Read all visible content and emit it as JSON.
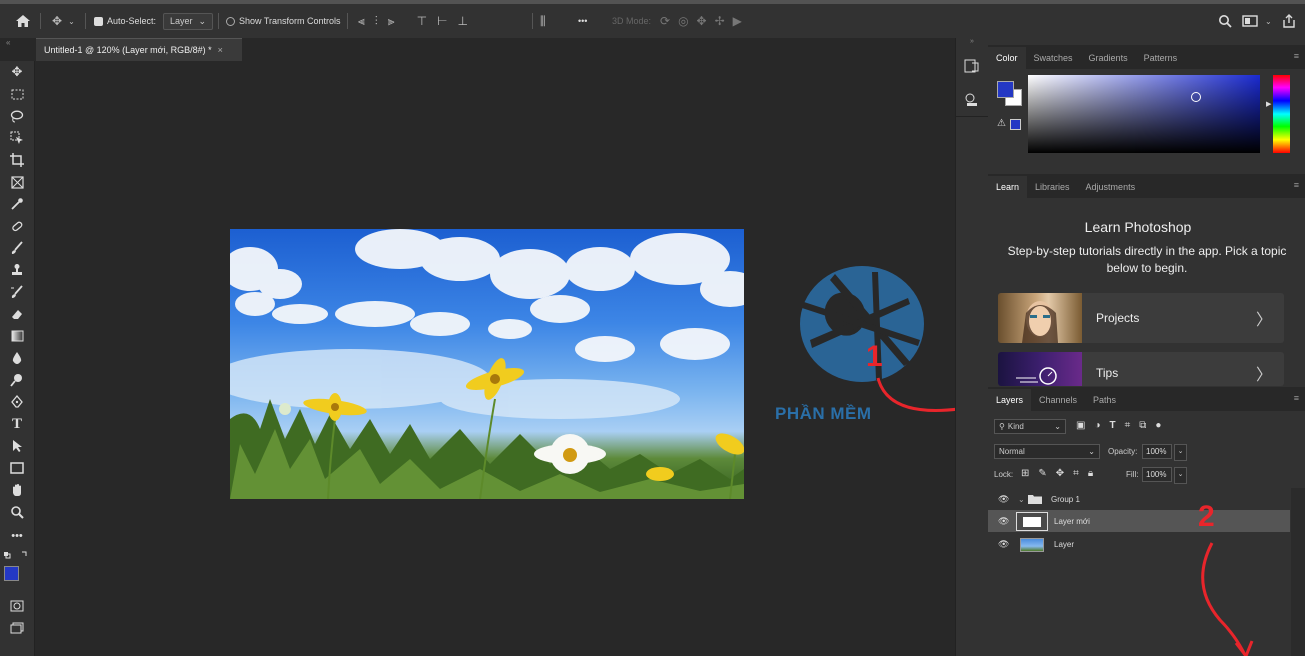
{
  "options_bar": {
    "auto_select_label": "Auto-Select:",
    "auto_select_value": "Layer",
    "show_transform_label": "Show Transform Controls",
    "threed_mode_label": "3D Mode:",
    "more_label": "•••"
  },
  "document": {
    "tab_title": "Untitled-1 @ 120% (Layer mới, RGB/8#) *",
    "close_label": "×"
  },
  "color_panel": {
    "tabs": [
      "Color",
      "Swatches",
      "Gradients",
      "Patterns"
    ],
    "foreground": "#2438c4",
    "background": "#ffffff"
  },
  "learn_panel": {
    "tabs": [
      "Learn",
      "Libraries",
      "Adjustments"
    ],
    "title": "Learn Photoshop",
    "description": "Step-by-step tutorials directly in the app. Pick a topic below to begin.",
    "cards": [
      {
        "label": "Projects"
      },
      {
        "label": "Tips"
      }
    ]
  },
  "layers_panel": {
    "tabs": [
      "Layers",
      "Channels",
      "Paths"
    ],
    "kind_label": "Kind",
    "blend_mode": "Normal",
    "opacity_label": "Opacity:",
    "opacity_value": "100%",
    "lock_label": "Lock:",
    "fill_label": "Fill:",
    "fill_value": "100%",
    "layers": [
      {
        "name": "Group 1",
        "type": "group",
        "selected": false
      },
      {
        "name": "Layer mới",
        "type": "layer",
        "selected": true
      },
      {
        "name": "Layer",
        "type": "image",
        "selected": false
      }
    ]
  },
  "watermark": {
    "text": "PHẦN MỀM"
  },
  "annotations": {
    "one": "1",
    "two": "2"
  },
  "colors": {
    "accent_red": "#e8252b",
    "watermark_blue": "#2a6fa8"
  }
}
